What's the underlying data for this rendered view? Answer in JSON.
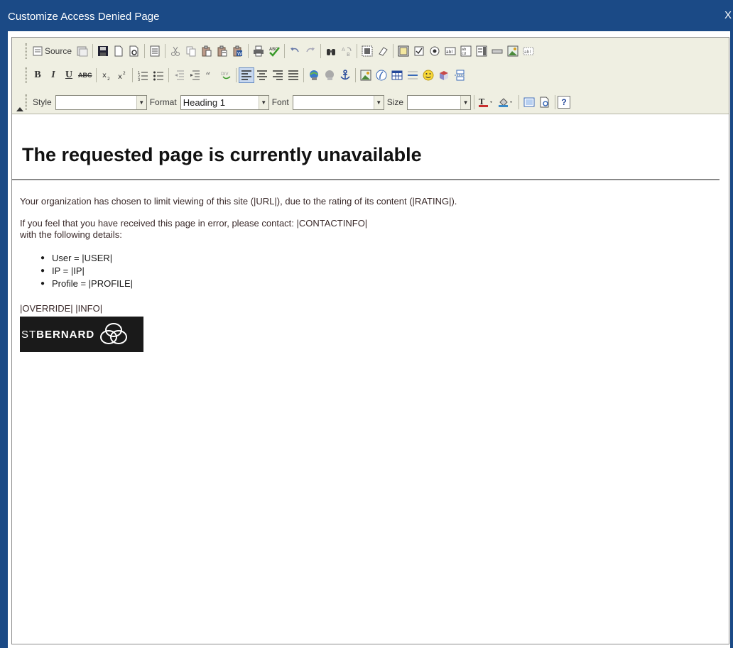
{
  "window": {
    "title": "Customize Access Denied Page",
    "close_glyph": "X"
  },
  "toolbar": {
    "source_label": "Source",
    "style_label": "Style",
    "style_value": "",
    "format_label": "Format",
    "format_value": "Heading 1",
    "font_label": "Font",
    "font_value": "",
    "size_label": "Size",
    "size_value": "",
    "bold_label": "B",
    "italic_label": "I",
    "underline_label": "U",
    "strike_label": "ABC",
    "help_label": "?"
  },
  "document": {
    "heading": "The requested page is currently unavailable",
    "paragraph1": "Your organization has chosen to limit viewing of this site (|URL|), due to the rating of its content (|RATING|).",
    "paragraph2_line1": "If you feel that you have received this page in error, please contact: |CONTACTINFO|",
    "paragraph2_line2": "with the following details:",
    "details": [
      "User = |USER|",
      "IP = |IP|",
      "Profile = |PROFILE|"
    ],
    "footer_tokens": "|OVERRIDE| |INFO|",
    "logo_text_prefix": "ST",
    "logo_text_main": "BERNARD"
  },
  "colors": {
    "titlebar": "#1b4a86",
    "toolbar_bg": "#efefe2",
    "logo_bg": "#1a1a1a"
  }
}
